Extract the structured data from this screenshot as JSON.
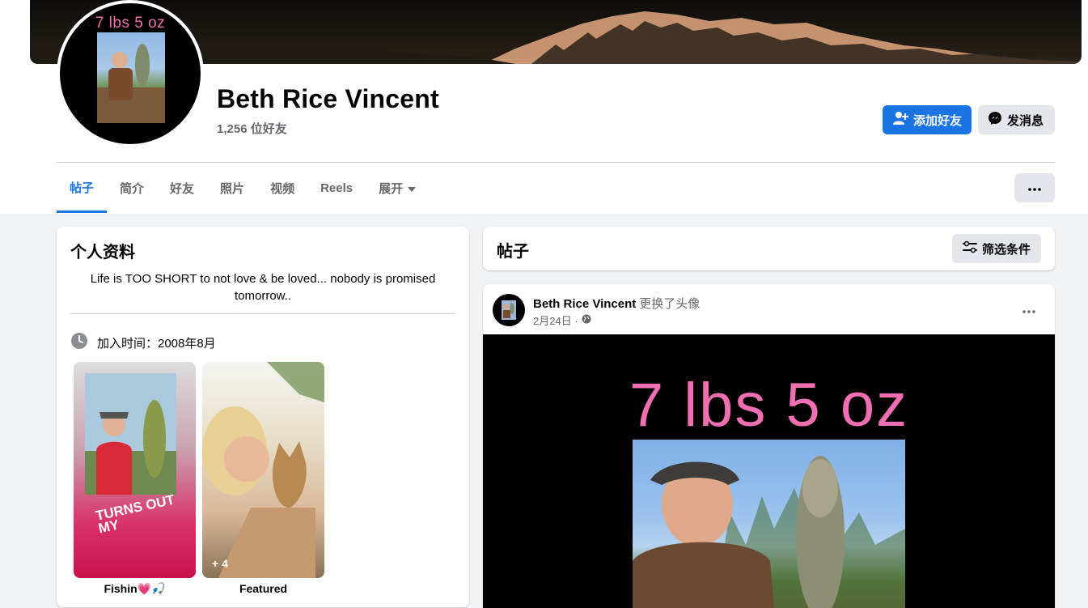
{
  "profile": {
    "name": "Beth Rice Vincent",
    "friends_count": "1,256 位好友",
    "avatar_text": "7 lbs 5 oz"
  },
  "actions": {
    "add_friend": "添加好友",
    "message": "发消息"
  },
  "tabs": [
    {
      "label": "帖子",
      "active": true
    },
    {
      "label": "简介"
    },
    {
      "label": "好友"
    },
    {
      "label": "照片"
    },
    {
      "label": "视频"
    },
    {
      "label": "Reels"
    },
    {
      "label": "展开"
    }
  ],
  "intro": {
    "title": "个人资料",
    "bio": "Life is TOO SHORT to not love & be loved... nobody is promised tomorrow..",
    "joined": "加入时间：2008年8月",
    "featured": [
      {
        "label": "Fishin💗🎣",
        "overlay": "TURNS OUT MY"
      },
      {
        "label": "Featured",
        "count": "+ 4"
      }
    ]
  },
  "posts": {
    "title": "帖子",
    "filter_label": "筛选条件",
    "post": {
      "author": "Beth Rice Vincent",
      "action": "更换了头像",
      "date": "2月24日 ·",
      "image_text": "7 lbs 5 oz"
    }
  },
  "colors": {
    "accent": "#1b74e4",
    "pink_text": "#f06fb3",
    "background": "#f0f2f5"
  }
}
